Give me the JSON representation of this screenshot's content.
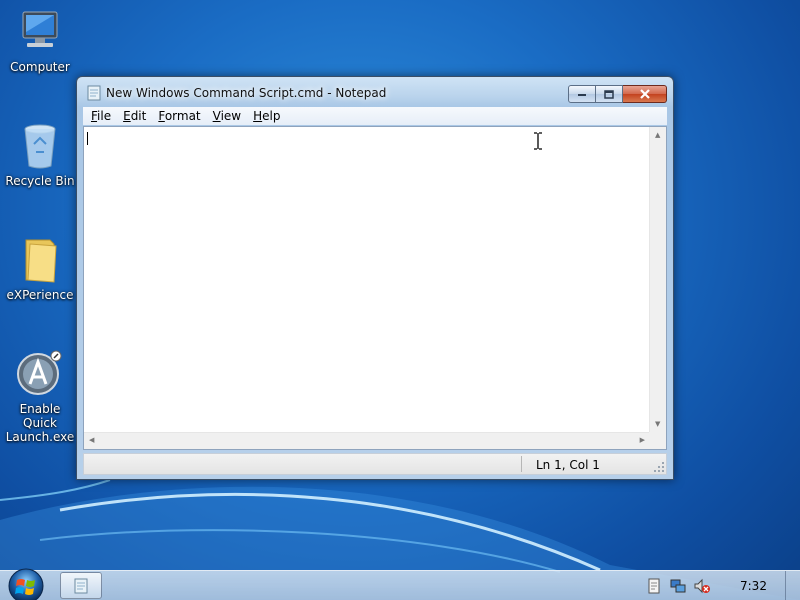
{
  "desktop": {
    "icons": [
      {
        "label": "Computer",
        "icon": "computer-icon"
      },
      {
        "label": "Recycle Bin",
        "icon": "recycle-bin-icon"
      },
      {
        "label": "eXPerience",
        "icon": "folder-icon"
      },
      {
        "label_line1": "Enable Quick",
        "label_line2": "Launch.exe",
        "icon": "quick-launch-icon"
      }
    ]
  },
  "window": {
    "title": "New Windows Command Script.cmd - Notepad",
    "menu": [
      {
        "underline": "F",
        "rest": "ile"
      },
      {
        "underline": "E",
        "rest": "dit"
      },
      {
        "underline": "F",
        "rest": "ormat"
      },
      {
        "underline": "V",
        "rest": "iew"
      },
      {
        "underline": "H",
        "rest": "elp"
      }
    ],
    "editor_text": "",
    "status": "Ln 1, Col 1"
  },
  "taskbar": {
    "clock": "7:32",
    "tray_icons": [
      "action-center-icon",
      "network-icon",
      "volume-muted-icon"
    ]
  },
  "colors": {
    "desktop_bg": "#1a6cc4",
    "close_button": "#c3421f"
  }
}
